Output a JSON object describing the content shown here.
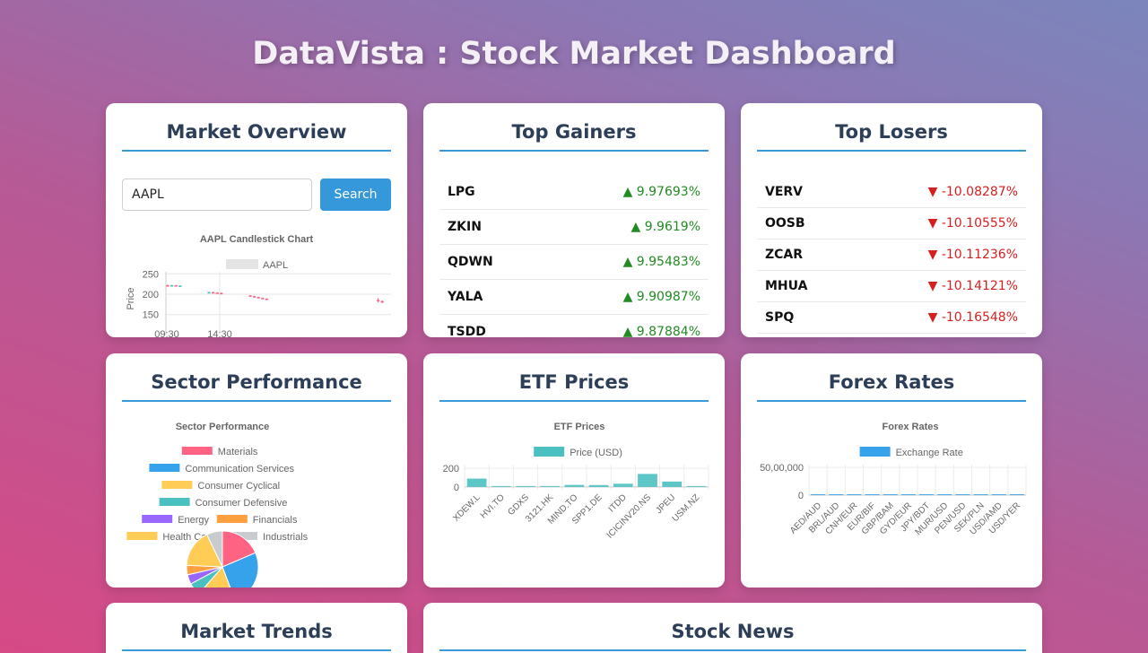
{
  "header": {
    "title": "DataVista : Stock Market Dashboard"
  },
  "colors": {
    "accent": "#3498db",
    "title_text": "#2c3e58",
    "gain": "#228b22",
    "loss": "#d62020",
    "teal": "#4bc0c0",
    "blue": "#36a2eb"
  },
  "market_overview": {
    "title": "Market Overview",
    "search": {
      "value": "AAPL",
      "placeholder": ""
    },
    "search_label": "Search"
  },
  "top_gainers": {
    "title": "Top Gainers",
    "items": [
      {
        "symbol": "LPG",
        "change": "9.97693%"
      },
      {
        "symbol": "ZKIN",
        "change": "9.9619%"
      },
      {
        "symbol": "QDWN",
        "change": "9.95483%"
      },
      {
        "symbol": "YALA",
        "change": "9.90987%"
      },
      {
        "symbol": "TSDD",
        "change": "9.87884%"
      }
    ]
  },
  "top_losers": {
    "title": "Top Losers",
    "items": [
      {
        "symbol": "VERV",
        "change": "-10.08287%"
      },
      {
        "symbol": "OOSB",
        "change": "-10.10555%"
      },
      {
        "symbol": "ZCAR",
        "change": "-10.11236%"
      },
      {
        "symbol": "MHUA",
        "change": "-10.14121%"
      },
      {
        "symbol": "SPQ",
        "change": "-10.16548%"
      }
    ]
  },
  "sector_performance": {
    "title": "Sector Performance"
  },
  "etf_prices": {
    "title": "ETF Prices"
  },
  "forex_rates": {
    "title": "Forex Rates"
  },
  "market_trends": {
    "title": "Market Trends"
  },
  "stock_news": {
    "title": "Stock News"
  },
  "chart_data": [
    {
      "type": "candlestick",
      "title": "AAPL Candlestick Chart",
      "legend": [
        "AAPL"
      ],
      "ylabel": "Price",
      "ylim": [
        145,
        255
      ],
      "yticks": [
        150,
        200,
        250
      ],
      "xticks": [
        "09:30",
        "14:30"
      ],
      "candles": [
        {
          "x": 0,
          "open": 222,
          "close": 221,
          "high": 224,
          "low": 220
        },
        {
          "x": 1,
          "open": 221,
          "close": 222,
          "high": 223,
          "low": 220
        },
        {
          "x": 2,
          "open": 222,
          "close": 221,
          "high": 223,
          "low": 220
        },
        {
          "x": 3,
          "open": 221,
          "close": 221,
          "high": 222,
          "low": 219
        },
        {
          "x": 10,
          "open": 204,
          "close": 205,
          "high": 206,
          "low": 203
        },
        {
          "x": 11,
          "open": 205,
          "close": 204,
          "high": 206,
          "low": 203
        },
        {
          "x": 12,
          "open": 204,
          "close": 203,
          "high": 205,
          "low": 202
        },
        {
          "x": 13,
          "open": 203,
          "close": 202,
          "high": 204,
          "low": 201
        },
        {
          "x": 20,
          "open": 197,
          "close": 195,
          "high": 198,
          "low": 194
        },
        {
          "x": 21,
          "open": 195,
          "close": 193,
          "high": 196,
          "low": 192
        },
        {
          "x": 22,
          "open": 193,
          "close": 191,
          "high": 194,
          "low": 190
        },
        {
          "x": 23,
          "open": 191,
          "close": 189,
          "high": 192,
          "low": 188
        },
        {
          "x": 24,
          "open": 189,
          "close": 188,
          "high": 190,
          "low": 187
        },
        {
          "x": 51,
          "open": 186,
          "close": 183,
          "high": 191,
          "low": 180
        },
        {
          "x": 52,
          "open": 183,
          "close": 180,
          "high": 185,
          "low": 178
        }
      ]
    },
    {
      "type": "pie",
      "title": "Sector Performance",
      "categories": [
        "Materials",
        "Communication Services",
        "Consumer Cyclical",
        "Consumer Defensive",
        "Energy",
        "Financials",
        "Health Care",
        "Industrials"
      ],
      "colors": [
        "#ff6384",
        "#36a2eb",
        "#ffcd56",
        "#4bc0c0",
        "#9966ff",
        "#ff9f40",
        "#ffcd56",
        "#c9cbcf"
      ],
      "values": [
        13,
        18,
        12,
        4,
        3,
        3,
        12,
        5
      ]
    },
    {
      "type": "bar",
      "title": "ETF Prices",
      "legend": [
        "Price (USD)"
      ],
      "categories": [
        "XDEW.L",
        "HVI.TO",
        "GDXS",
        "3121.HK",
        "MIND.TO",
        "SPP1.DE",
        "ITDD",
        "ICICINV20.NS",
        "JPEU",
        "USM.NZ"
      ],
      "values": [
        90,
        5,
        4,
        10,
        22,
        20,
        35,
        140,
        58,
        6
      ],
      "ylim": [
        -30,
        240
      ],
      "yticks": [
        0,
        200
      ],
      "ytick_labels": [
        "0",
        "200"
      ]
    },
    {
      "type": "bar",
      "title": "Forex Rates",
      "legend": [
        "Exchange Rate"
      ],
      "categories": [
        "AED/AUD",
        "BRL/AUD",
        "CNH/EUR",
        "EUR/BIF",
        "GBP/BAM",
        "GYD/EUR",
        "JPY/BDT",
        "MUR/USD",
        "PEN/USD",
        "SEK/PLN",
        "USD/AMD",
        "USD/YER"
      ],
      "values": [
        0,
        0,
        0,
        3000,
        0,
        0,
        1,
        0,
        0,
        0,
        390,
        250
      ],
      "ylim": [
        0,
        5500000
      ],
      "yticks": [
        0,
        5000000
      ],
      "ytick_labels": [
        "0",
        "50,00,000"
      ]
    }
  ]
}
